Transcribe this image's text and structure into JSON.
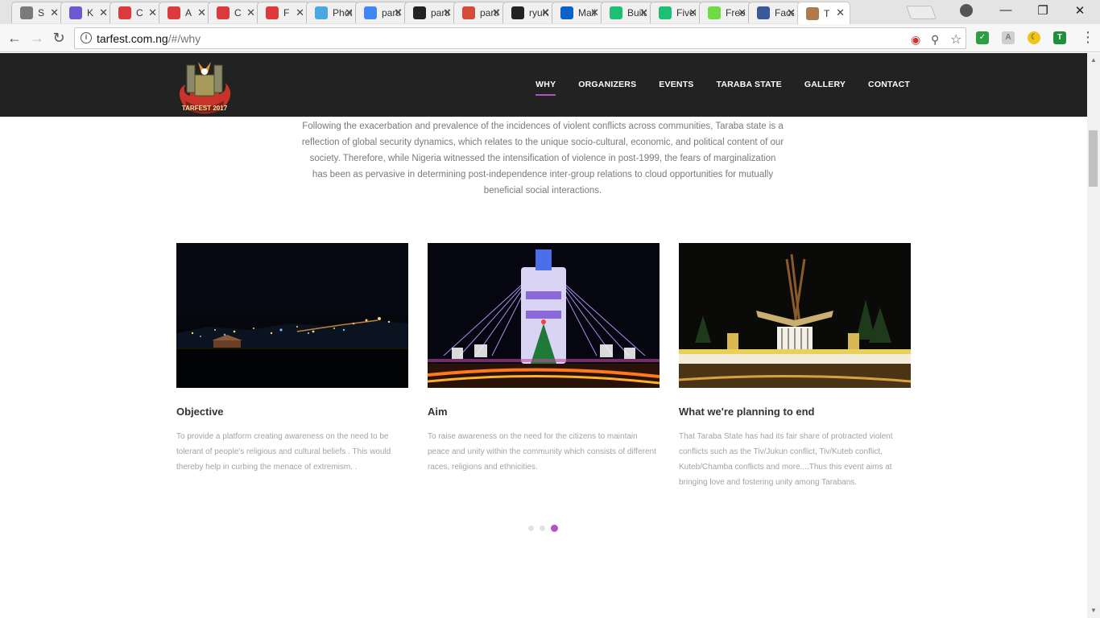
{
  "browser": {
    "tabs": [
      {
        "title": "S",
        "favicon": "gear-icon",
        "color": "#7a7a7a"
      },
      {
        "title": "K",
        "favicon": "az-icon",
        "color": "#6a5acd"
      },
      {
        "title": "C",
        "favicon": "angular-icon",
        "color": "#dd3b3b"
      },
      {
        "title": "A",
        "favicon": "angular-icon",
        "color": "#dd3b3b"
      },
      {
        "title": "C",
        "favicon": "angular-icon",
        "color": "#dd3b3b"
      },
      {
        "title": "F",
        "favicon": "angular-icon",
        "color": "#dd3b3b"
      },
      {
        "title": "Phot",
        "favicon": "photo-icon",
        "color": "#4aa8e0"
      },
      {
        "title": "parti",
        "favicon": "google-icon",
        "color": "#4285f4"
      },
      {
        "title": "parti",
        "favicon": "square-icon",
        "color": "#222222"
      },
      {
        "title": "parti",
        "favicon": "n-icon",
        "color": "#d44b3b"
      },
      {
        "title": "ryuKi",
        "favicon": "github-icon",
        "color": "#222222"
      },
      {
        "title": "Mail",
        "favicon": "outlook-icon",
        "color": "#0a64c8"
      },
      {
        "title": "Build",
        "favicon": "fiverr-icon",
        "color": "#1dbf73"
      },
      {
        "title": "Fiver",
        "favicon": "fiverr-icon",
        "color": "#1dbf73"
      },
      {
        "title": "Freel",
        "favicon": "upwork-icon",
        "color": "#6fda44"
      },
      {
        "title": "Face",
        "favicon": "facebook-icon",
        "color": "#3b5998"
      },
      {
        "title": "T",
        "favicon": "tarfest-icon",
        "color": "#b07a4a"
      }
    ],
    "url_host": "tarfest.com.ng",
    "url_path": "/#/why"
  },
  "site": {
    "nav": [
      "WHY",
      "ORGANIZERS",
      "EVENTS",
      "TARABA STATE",
      "GALLERY",
      "CONTACT"
    ],
    "active_nav": "WHY",
    "accent": "#b153c6",
    "logo_text": "TARFEST 2017",
    "intro": "Following the exacerbation and prevalence of the incidences of violent conflicts across communities, Taraba state is a reflection of global security dynamics, which relates to the unique socio-cultural, economic, and political content of our society. Therefore, while Nigeria witnessed the intensification of violence in post-1999, the fears of marginalization has been as pervasive in determining post-independence inter-group relations to cloud opportunities for mutually beneficial social interactions.",
    "cards": [
      {
        "title": "Objective",
        "text": "To provide a platform  creating awareness on the need to be tolerant of people's religious and cultural beliefs . This would thereby help in curbing the menace of extremism. .",
        "image": "city-at-night-image"
      },
      {
        "title": "Aim",
        "text": "To raise awareness on the need for the citizens to maintain peace and unity within the community which consists of different races, religions and ethnicities.",
        "image": "illuminated-monument-image"
      },
      {
        "title": "What we're planning to end",
        "text": "That Taraba State has had its fair share of protracted violent conflicts such as the Tiv/Jukun conflict, Tiv/Kuteb conflict, Kuteb/Chamba conflicts and more....Thus this event aims at bringing love and fostering unity among Tarabans.",
        "image": "roundabout-monument-image"
      }
    ],
    "carousel_pages": 3,
    "carousel_active": 3
  }
}
